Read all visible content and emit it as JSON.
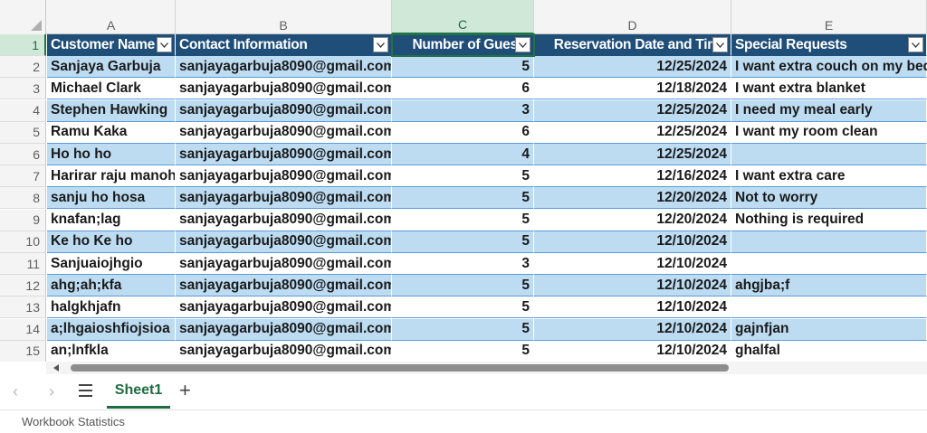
{
  "columns": [
    "A",
    "B",
    "C",
    "D",
    "E"
  ],
  "selected_column": "C",
  "selected_row": "1",
  "headers": [
    "Customer Name",
    "Contact Information",
    "Number of Guests",
    "Reservation Date and Time",
    "Special Requests"
  ],
  "rows": [
    {
      "num": "1"
    },
    {
      "num": "2",
      "cells": [
        "Sanjaya Garbuja",
        "sanjayagarbuja8090@gmail.com",
        "5",
        "12/25/2024",
        "I want extra couch on my bed."
      ]
    },
    {
      "num": "3",
      "cells": [
        "Michael Clark",
        "sanjayagarbuja8090@gmail.com",
        "6",
        "12/18/2024",
        "I want extra blanket"
      ]
    },
    {
      "num": "4",
      "cells": [
        "Stephen Hawking",
        "sanjayagarbuja8090@gmail.com",
        "3",
        "12/25/2024",
        "I need my meal early"
      ]
    },
    {
      "num": "5",
      "cells": [
        "Ramu Kaka",
        "sanjayagarbuja8090@gmail.com",
        "6",
        "12/25/2024",
        "I want my room clean"
      ]
    },
    {
      "num": "6",
      "cells": [
        "Ho ho ho",
        "sanjayagarbuja8090@gmail.com",
        "4",
        "12/25/2024",
        ""
      ]
    },
    {
      "num": "7",
      "cells": [
        "Harirar raju manoha",
        "sanjayagarbuja8090@gmail.com",
        "5",
        "12/16/2024",
        "I want extra care"
      ]
    },
    {
      "num": "8",
      "cells": [
        "sanju ho hosa",
        "sanjayagarbuja8090@gmail.com",
        "5",
        "12/20/2024",
        "Not to worry"
      ]
    },
    {
      "num": "9",
      "cells": [
        "knafan;lag",
        "sanjayagarbuja8090@gmail.com",
        "5",
        "12/20/2024",
        "Nothing is required"
      ]
    },
    {
      "num": "10",
      "cells": [
        "Ke ho Ke ho",
        "sanjayagarbuja8090@gmail.com",
        "5",
        "12/10/2024",
        ""
      ]
    },
    {
      "num": "11",
      "cells": [
        "Sanjuaiojhgio",
        "sanjayagarbuja8090@gmail.com",
        "3",
        "12/10/2024",
        ""
      ]
    },
    {
      "num": "12",
      "cells": [
        "ahg;ah;kfa",
        "sanjayagarbuja8090@gmail.com",
        "5",
        "12/10/2024",
        "ahgjba;f"
      ]
    },
    {
      "num": "13",
      "cells": [
        "halgkhjafn",
        "sanjayagarbuja8090@gmail.com",
        "5",
        "12/10/2024",
        ""
      ]
    },
    {
      "num": "14",
      "cells": [
        "a;lhgaioshfiojsioa",
        "sanjayagarbuja8090@gmail.com",
        "5",
        "12/10/2024",
        "gajnfjan"
      ]
    },
    {
      "num": "15",
      "cells": [
        "an;lnfkla",
        "sanjayagarbuja8090@gmail.com",
        "5",
        "12/10/2024",
        "ghalfal"
      ]
    }
  ],
  "sheet_tabs": {
    "prev_icon": "chevron-left-icon",
    "next_icon": "chevron-right-icon",
    "menu_icon": "hamburger-menu-icon",
    "active_sheet": "Sheet1",
    "add_icon": "plus-icon"
  },
  "status": {
    "label": "Workbook Statistics"
  },
  "colors": {
    "header_fill": "#1f4e79",
    "band_fill": "#bddcf2",
    "accent": "#217346"
  }
}
